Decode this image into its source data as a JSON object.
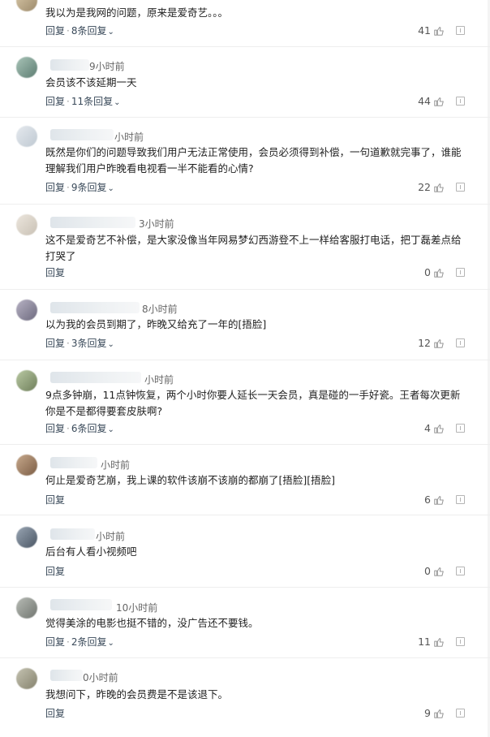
{
  "labels": {
    "reply": "回复",
    "dot": "·"
  },
  "comments": [
    {
      "time": "",
      "text": "我以为是我网的问题，原来是爱奇艺。。。",
      "replies": "8条回复",
      "likes": "41"
    },
    {
      "time": "9小时前",
      "text": "会员该不该延期一天",
      "replies": "11条回复",
      "likes": "44"
    },
    {
      "time": "小时前",
      "text": "既然是你们的问题导致我们用户无法正常使用，会员必须得到补偿，一句道歉就完事了，谁能理解我们用户昨晚看电视看一半不能看的心情?",
      "replies": "9条回复",
      "likes": "22"
    },
    {
      "time": "3小时前",
      "text": "这不是爱奇艺不补偿，是大家没像当年网易梦幻西游登不上一样给客服打电话，把丁磊差点给打哭了",
      "replies": "",
      "likes": "0"
    },
    {
      "time": "8小时前",
      "text": "以为我的会员到期了，昨晚又给充了一年的[捂脸]",
      "replies": "3条回复",
      "likes": "12"
    },
    {
      "time": "小时前",
      "text": "9点多钟崩，11点钟恢复，两个小时你要人延长一天会员，真是碰的一手好瓷。王者每次更新你是不是都得要套皮肤啊?",
      "replies": "6条回复",
      "likes": "4"
    },
    {
      "time": "小时前",
      "text": "何止是爱奇艺崩，我上课的软件该崩不该崩的都崩了[捂脸][捂脸]",
      "replies": "",
      "likes": "6"
    },
    {
      "time": "小时前",
      "text": "后台有人看小视频吧",
      "replies": "",
      "likes": "0"
    },
    {
      "time": "10小时前",
      "text": "觉得美涂的电影也挺不错的，没广告还不要钱。",
      "replies": "2条回复",
      "likes": "11"
    },
    {
      "time": "0小时前",
      "text": "我想问下，昨晚的会员费是不是该退下。",
      "replies": "",
      "likes": "9"
    }
  ]
}
